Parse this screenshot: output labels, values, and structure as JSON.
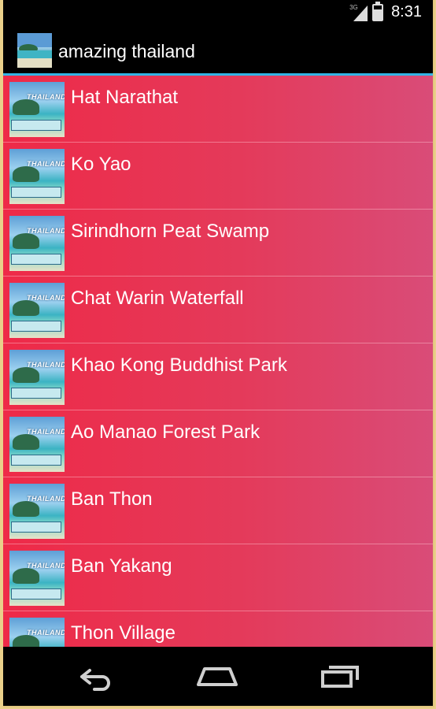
{
  "status": {
    "network": "3G",
    "time": "8:31",
    "battery_level": 0.7
  },
  "app": {
    "title": "amazing thailand",
    "icon": "thailand-beach-icon"
  },
  "list": {
    "items": [
      {
        "label": "Hat Narathat"
      },
      {
        "label": "Ko Yao"
      },
      {
        "label": "Sirindhorn Peat Swamp"
      },
      {
        "label": "Chat Warin Waterfall"
      },
      {
        "label": "Khao Kong Buddhist Park"
      },
      {
        "label": "Ao Manao Forest Park"
      },
      {
        "label": "Ban Thon"
      },
      {
        "label": "Ban Yakang"
      },
      {
        "label": "Thon Village"
      }
    ],
    "thumbnail_icon": "thailand-beach-thumbnail-icon",
    "thumbnail_text": "THAILAND"
  },
  "nav": {
    "back_icon": "back-icon",
    "home_icon": "home-icon",
    "recents_icon": "recent-apps-icon"
  },
  "colors": {
    "list_gradient_start": "#ee2a48",
    "list_gradient_end": "#d94c78",
    "action_bar_divider": "#33b5e5",
    "frame": "#ead08a"
  }
}
